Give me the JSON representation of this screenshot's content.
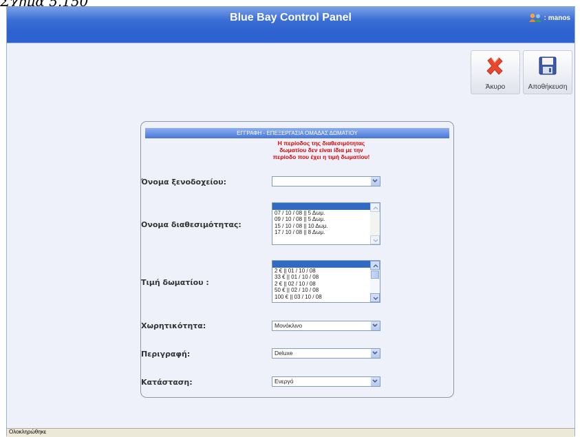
{
  "caption": "Σχήμα 5.150",
  "header": {
    "title": "Blue Bay Control Panel",
    "user_label": ": manos"
  },
  "toolbar": {
    "cancel_label": "Άκυρο",
    "save_label": "Αποθήκευση"
  },
  "panel": {
    "title": "ΕΓΓΡΑΦΗ - ΕΠΕΞΕΡΓΑΣΙΑ ΟΜΑΔΑΣ ΔΩΜΑΤΙΟΥ",
    "warning": [
      "Η περίοδος της διαθεσιμότητας",
      "δωματίου δεν είναι ίδια με την",
      "περίοδο που έχει η τιμή δωματίου!"
    ]
  },
  "form": {
    "hotel_label": "Όνομα ξενοδοχείου:",
    "hotel_value": "",
    "availability_label": "Ονομα διαθεσιμότητας:",
    "availability_options": [
      "",
      "07 / 10 / 08 || 5 Δωμ.",
      "09 / 10 / 08 || 5 Δωμ.",
      "15 / 10 / 08 || 10 Δωμ.",
      "17 / 10 / 08 || 8 Δωμ."
    ],
    "price_label": "Τιμή δωματίου :",
    "price_options": [
      "",
      "2 € || 01 / 10 / 08",
      "33 € || 01 / 10 / 08",
      "2 € || 02 / 10 / 08",
      "50 € || 02 / 10 / 08",
      "100 € || 03 / 10 / 08"
    ],
    "capacity_label": "Χωρητικότητα:",
    "capacity_value": "Μονόκλινο",
    "description_label": "Περιγραφή:",
    "description_value": "Deluxe",
    "status_label": "Κατάσταση:",
    "status_value": "Ενεργό"
  },
  "statusbar": {
    "text": "Ολοκληρώθηκε"
  },
  "colors": {
    "title_bar": "#3b6fd6",
    "warning": "#e00000",
    "selection": "#316ac5"
  }
}
